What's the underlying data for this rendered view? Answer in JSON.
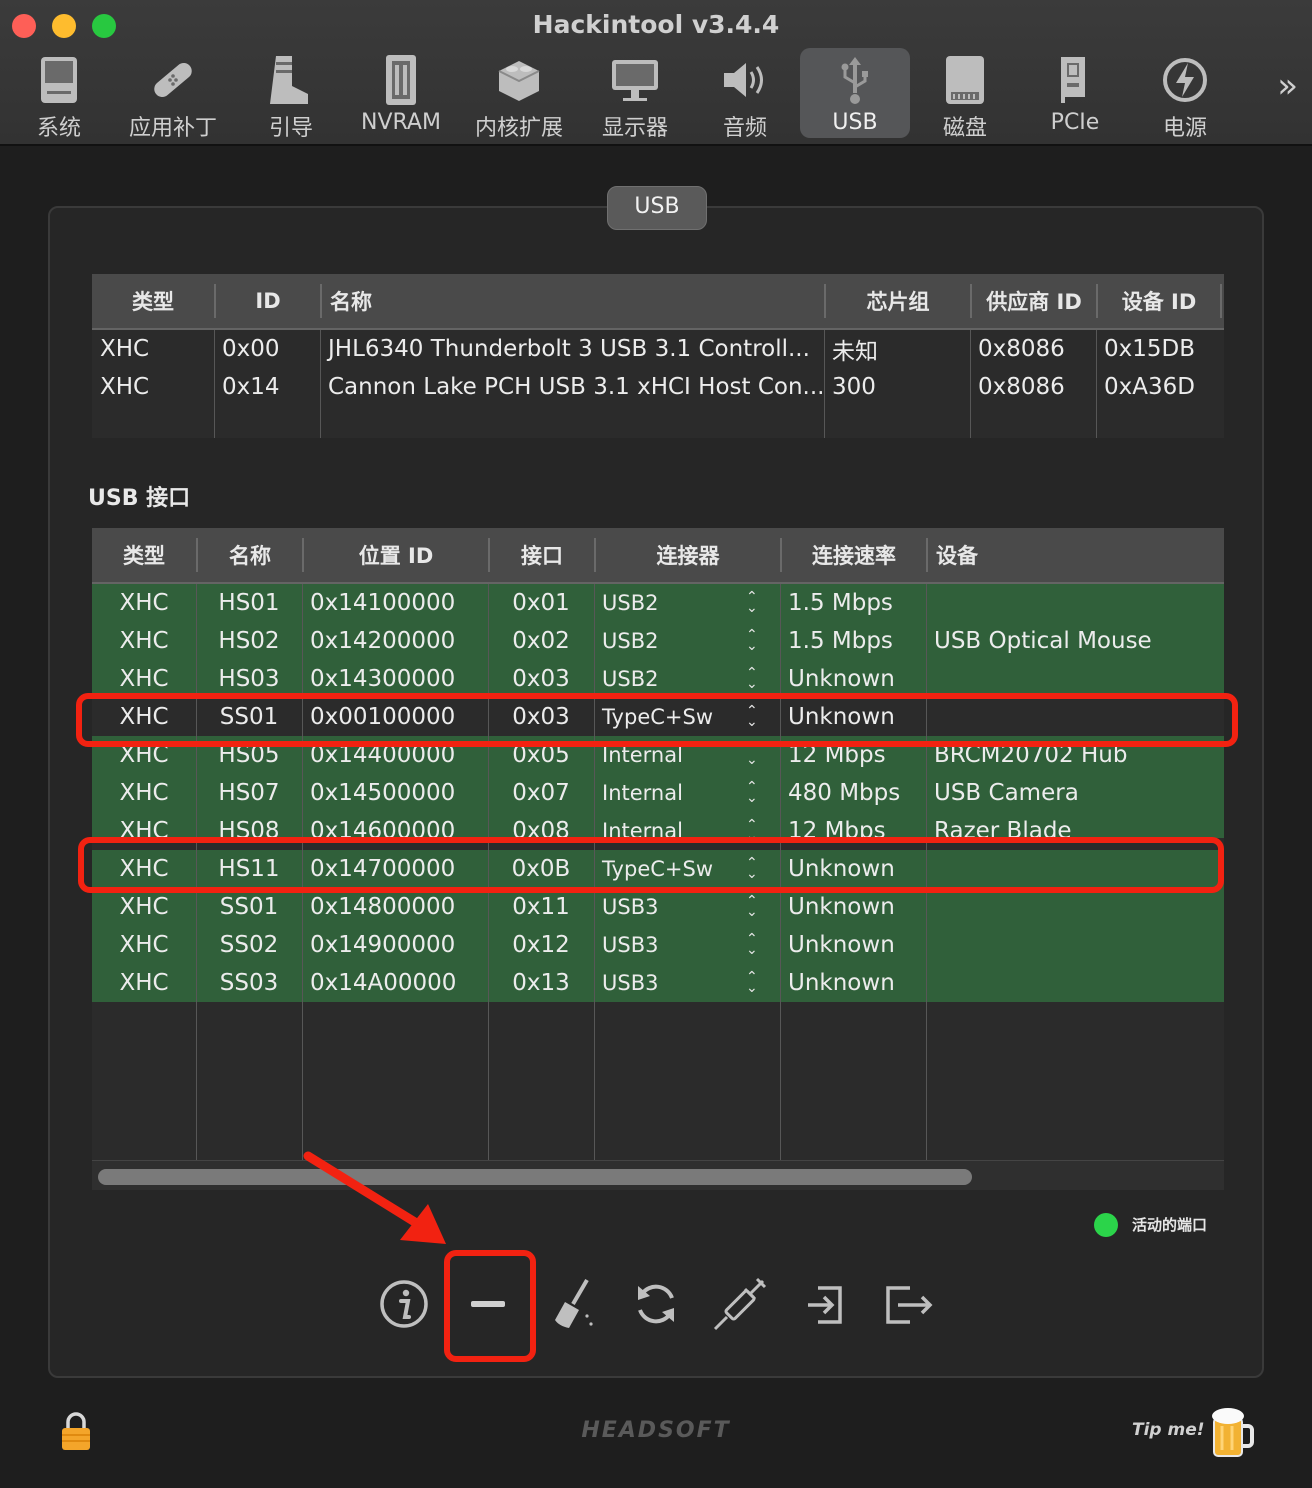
{
  "window": {
    "title": "Hackintool v3.4.4"
  },
  "toolbar": {
    "items": [
      {
        "label": "系统",
        "icon": "computer-icon"
      },
      {
        "label": "应用补丁",
        "icon": "bandage-icon"
      },
      {
        "label": "引导",
        "icon": "boot-icon"
      },
      {
        "label": "NVRAM",
        "icon": "nvram-chip-icon"
      },
      {
        "label": "内核扩展",
        "icon": "lego-brick-icon"
      },
      {
        "label": "显示器",
        "icon": "display-icon"
      },
      {
        "label": "音频",
        "icon": "speaker-icon"
      },
      {
        "label": "USB",
        "icon": "usb-icon",
        "active": true
      },
      {
        "label": "磁盘",
        "icon": "disk-icon"
      },
      {
        "label": "PCIe",
        "icon": "pcie-card-icon"
      },
      {
        "label": "电源",
        "icon": "power-bolt-icon"
      }
    ],
    "more": "»"
  },
  "group": {
    "tab_label": "USB"
  },
  "controllers": {
    "headers": [
      "类型",
      "ID",
      "名称",
      "芯片组",
      "供应商 ID",
      "设备 ID"
    ],
    "rows": [
      [
        "XHC",
        "0x00",
        "JHL6340 Thunderbolt 3 USB 3.1 Controll...",
        "未知",
        "0x8086",
        "0x15DB"
      ],
      [
        "XHC",
        "0x14",
        "Cannon Lake PCH USB 3.1 xHCI Host Con...",
        "300",
        "0x8086",
        "0xA36D"
      ]
    ]
  },
  "ports_section": {
    "title": "USB 接口"
  },
  "ports": {
    "headers": [
      "类型",
      "名称",
      "位置 ID",
      "接口",
      "连接器",
      "连接速率",
      "设备"
    ],
    "rows": [
      [
        "XHC",
        "HS01",
        "0x14100000",
        "0x01",
        "USB2",
        "1.5 Mbps",
        ""
      ],
      [
        "XHC",
        "HS02",
        "0x14200000",
        "0x02",
        "USB2",
        "1.5 Mbps",
        "USB Optical Mouse"
      ],
      [
        "XHC",
        "HS03",
        "0x14300000",
        "0x03",
        "USB2",
        "Unknown",
        ""
      ],
      [
        "XHC",
        "SS01",
        "0x00100000",
        "0x03",
        "TypeC+Sw",
        "Unknown",
        ""
      ],
      [
        "XHC",
        "HS05",
        "0x14400000",
        "0x05",
        "Internal",
        "12 Mbps",
        "BRCM20702 Hub"
      ],
      [
        "XHC",
        "HS07",
        "0x14500000",
        "0x07",
        "Internal",
        "480 Mbps",
        "USB Camera"
      ],
      [
        "XHC",
        "HS08",
        "0x14600000",
        "0x08",
        "Internal",
        "12 Mbps",
        "Razer Blade"
      ],
      [
        "XHC",
        "HS11",
        "0x14700000",
        "0x0B",
        "TypeC+Sw",
        "Unknown",
        ""
      ],
      [
        "XHC",
        "SS01",
        "0x14800000",
        "0x11",
        "USB3",
        "Unknown",
        ""
      ],
      [
        "XHC",
        "SS02",
        "0x14900000",
        "0x12",
        "USB3",
        "Unknown",
        ""
      ],
      [
        "XHC",
        "SS03",
        "0x14A00000",
        "0x13",
        "USB3",
        "Unknown",
        ""
      ]
    ],
    "stepper_glyph": "⌃⌄"
  },
  "legend": {
    "active_label": "活动的端口",
    "active_color": "#2bd44a"
  },
  "actions": [
    {
      "name": "info-button",
      "icon": "info-icon"
    },
    {
      "name": "remove-button",
      "icon": "minus-icon"
    },
    {
      "name": "clear-button",
      "icon": "broom-icon"
    },
    {
      "name": "refresh-button",
      "icon": "refresh-icon"
    },
    {
      "name": "inject-button",
      "icon": "syringe-icon"
    },
    {
      "name": "import-button",
      "icon": "import-icon"
    },
    {
      "name": "export-button",
      "icon": "export-icon"
    }
  ],
  "footer": {
    "brand": "HEADSOFT",
    "tip": "Tip me!"
  },
  "colors": {
    "highlight": "#f22211",
    "row_green": "#30603a",
    "active_tab": "#555658"
  }
}
